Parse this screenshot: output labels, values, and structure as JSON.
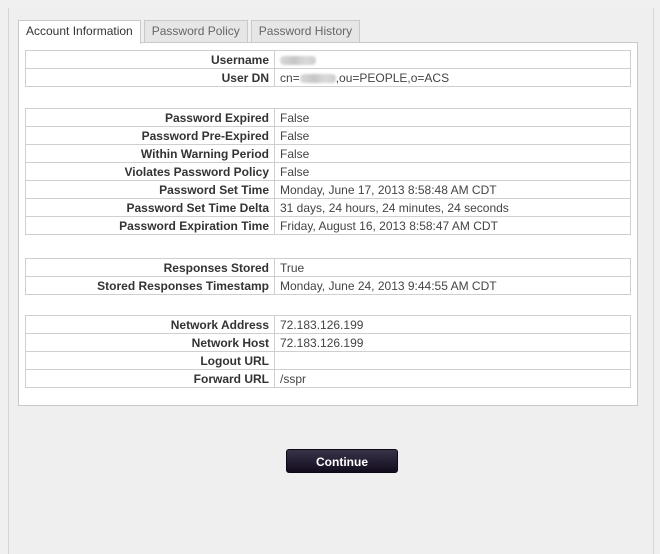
{
  "tabs": [
    {
      "label": "Account Information",
      "active": true
    },
    {
      "label": "Password Policy",
      "active": false
    },
    {
      "label": "Password History",
      "active": false
    }
  ],
  "identity": {
    "username_label": "Username",
    "userdn_label": "User DN",
    "userdn_prefix": "cn=",
    "userdn_suffix": ",ou=PEOPLE,o=ACS"
  },
  "password_status": {
    "rows": [
      {
        "label": "Password Expired",
        "value": "False"
      },
      {
        "label": "Password Pre-Expired",
        "value": "False"
      },
      {
        "label": "Within Warning Period",
        "value": "False"
      },
      {
        "label": "Violates Password Policy",
        "value": "False"
      },
      {
        "label": "Password Set Time",
        "value": "Monday, June 17, 2013 8:58:48 AM CDT"
      },
      {
        "label": "Password Set Time Delta",
        "value": "31 days, 24 hours, 24 minutes, 24 seconds"
      },
      {
        "label": "Password Expiration Time",
        "value": "Friday, August 16, 2013 8:58:47 AM CDT"
      }
    ]
  },
  "responses": {
    "rows": [
      {
        "label": "Responses Stored",
        "value": "True"
      },
      {
        "label": "Stored Responses Timestamp",
        "value": "Monday, June 24, 2013 9:44:55 AM CDT"
      }
    ]
  },
  "network": {
    "rows": [
      {
        "label": "Network Address",
        "value": "72.183.126.199"
      },
      {
        "label": "Network Host",
        "value": "72.183.126.199"
      },
      {
        "label": "Logout URL",
        "value": ""
      },
      {
        "label": "Forward URL",
        "value": "/sspr"
      }
    ]
  },
  "continue_label": "Continue",
  "colors": {
    "button": "#1a1424",
    "panel_border": "#c9c9c9",
    "background": "#efefef"
  }
}
